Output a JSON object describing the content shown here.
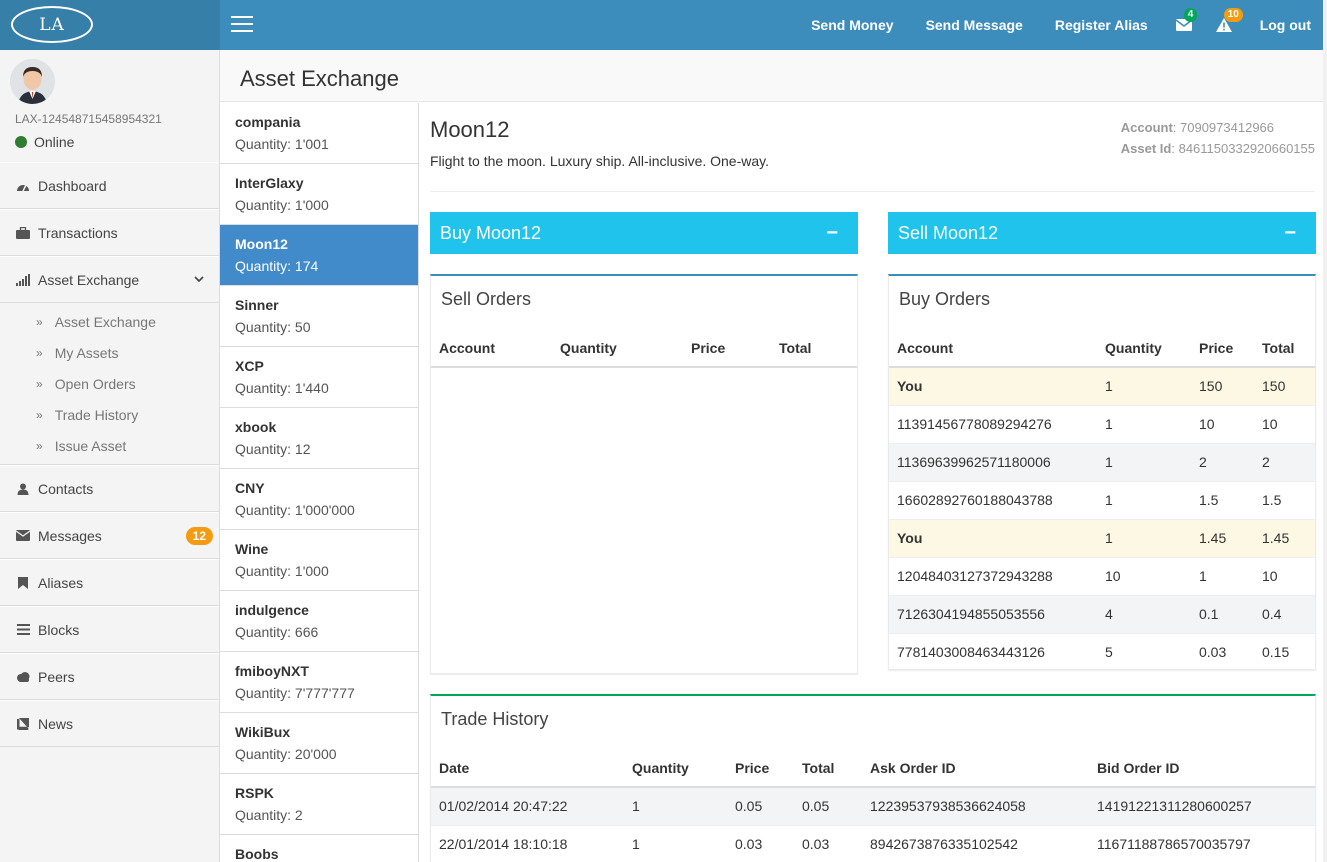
{
  "topbar": {
    "logo_text": "LA",
    "links": [
      "Send Money",
      "Send Message",
      "Register Alias"
    ],
    "mail_badge": "4",
    "alert_badge": "10",
    "logout": "Log out"
  },
  "user": {
    "id": "LAX-124548715458954321",
    "status": "Online"
  },
  "sidebar": {
    "items": [
      {
        "label": "Dashboard",
        "icon": "dashboard-icon"
      },
      {
        "label": "Transactions",
        "icon": "briefcase-icon"
      },
      {
        "label": "Asset Exchange",
        "icon": "signal-icon"
      },
      {
        "label": "Contacts",
        "icon": "user-icon"
      },
      {
        "label": "Messages",
        "icon": "envelope-icon",
        "badge": "12"
      },
      {
        "label": "Aliases",
        "icon": "bookmark-icon"
      },
      {
        "label": "Blocks",
        "icon": "list-icon"
      },
      {
        "label": "Peers",
        "icon": "cloud-icon"
      },
      {
        "label": "News",
        "icon": "book-icon"
      }
    ],
    "subitems": [
      "Asset Exchange",
      "My Assets",
      "Open Orders",
      "Trade History",
      "Issue Asset"
    ]
  },
  "page": {
    "title": "Asset Exchange"
  },
  "assets": [
    {
      "name": "compania",
      "qty": "Quantity: 1'001"
    },
    {
      "name": "InterGlaxy",
      "qty": "Quantity: 1'000"
    },
    {
      "name": "Moon12",
      "qty": "Quantity: 174"
    },
    {
      "name": "Sinner",
      "qty": "Quantity: 50"
    },
    {
      "name": "XCP",
      "qty": "Quantity: 1'440"
    },
    {
      "name": "xbook",
      "qty": "Quantity: 12"
    },
    {
      "name": "CNY",
      "qty": "Quantity: 1'000'000"
    },
    {
      "name": "Wine",
      "qty": "Quantity: 1'000"
    },
    {
      "name": "indulgence",
      "qty": "Quantity: 666"
    },
    {
      "name": "fmiboyNXT",
      "qty": "Quantity: 7'777'777"
    },
    {
      "name": "WikiBux",
      "qty": "Quantity: 20'000"
    },
    {
      "name": "RSPK",
      "qty": "Quantity: 2"
    },
    {
      "name": "Boobs",
      "qty": ""
    }
  ],
  "detail": {
    "name": "Moon12",
    "description": "Flight to the moon. Luxury ship. All-inclusive. One-way.",
    "account_label": "Account",
    "account": "7090973412966",
    "asset_id_label": "Asset Id",
    "asset_id": "8461150332920660155",
    "buy_button": "Buy Moon12",
    "sell_button": "Sell Moon12",
    "minus": "−"
  },
  "sell_orders": {
    "title": "Sell Orders",
    "columns": [
      "Account",
      "Quantity",
      "Price",
      "Total"
    ]
  },
  "buy_orders": {
    "title": "Buy Orders",
    "columns": [
      "Account",
      "Quantity",
      "Price",
      "Total"
    ],
    "rows": [
      [
        "You",
        "1",
        "150",
        "150"
      ],
      [
        "11391456778089294276",
        "1",
        "10",
        "10"
      ],
      [
        "11369639962571180006",
        "1",
        "2",
        "2"
      ],
      [
        "16602892760188043788",
        "1",
        "1.5",
        "1.5"
      ],
      [
        "You",
        "1",
        "1.45",
        "1.45"
      ],
      [
        "12048403127372943288",
        "10",
        "1",
        "10"
      ],
      [
        "7126304194855053556",
        "4",
        "0.1",
        "0.4"
      ],
      [
        "7781403008463443126",
        "5",
        "0.03",
        "0.15"
      ]
    ]
  },
  "trade_history": {
    "title": "Trade History",
    "columns": [
      "Date",
      "Quantity",
      "Price",
      "Total",
      "Ask Order ID",
      "Bid Order ID"
    ],
    "rows": [
      [
        "01/02/2014 20:47:22",
        "1",
        "0.05",
        "0.05",
        "12239537938536624058",
        "14191221311280600257"
      ],
      [
        "22/01/2014 18:10:18",
        "1",
        "0.03",
        "0.03",
        "8942673876335102542",
        "11671188786570035797"
      ]
    ]
  }
}
